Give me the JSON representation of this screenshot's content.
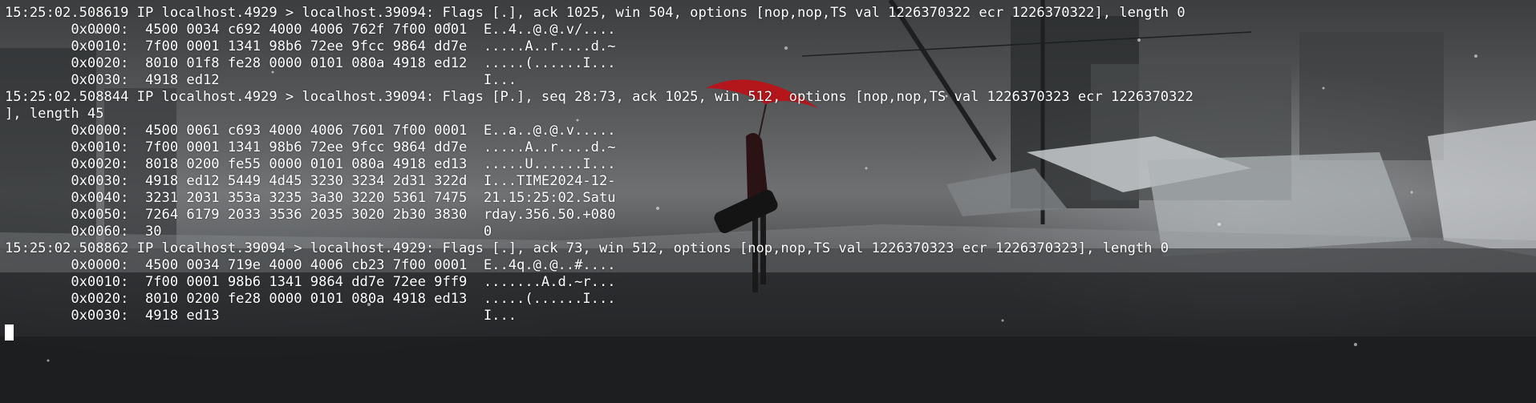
{
  "terminal": {
    "lines": [
      "15:25:02.508619 IP localhost.4929 > localhost.39094: Flags [.], ack 1025, win 504, options [nop,nop,TS val 1226370322 ecr 1226370322], length 0",
      "        0x0000:  4500 0034 c692 4000 4006 762f 7f00 0001  E..4..@.@.v/....",
      "        0x0010:  7f00 0001 1341 98b6 72ee 9fcc 9864 dd7e  .....A..r....d.~",
      "        0x0020:  8010 01f8 fe28 0000 0101 080a 4918 ed12  .....(......I...",
      "        0x0030:  4918 ed12                                I...",
      "15:25:02.508844 IP localhost.4929 > localhost.39094: Flags [P.], seq 28:73, ack 1025, win 512, options [nop,nop,TS val 1226370323 ecr 1226370322",
      "], length 45",
      "        0x0000:  4500 0061 c693 4000 4006 7601 7f00 0001  E..a..@.@.v.....",
      "        0x0010:  7f00 0001 1341 98b6 72ee 9fcc 9864 dd7e  .....A..r....d.~",
      "        0x0020:  8018 0200 fe55 0000 0101 080a 4918 ed13  .....U......I...",
      "        0x0030:  4918 ed12 5449 4d45 3230 3234 2d31 322d  I...TIME2024-12-",
      "        0x0040:  3231 2031 353a 3235 3a30 3220 5361 7475  21.15:25:02.Satu",
      "        0x0050:  7264 6179 2033 3536 2035 3020 2b30 3830  rday.356.50.+080",
      "        0x0060:  30                                       0",
      "15:25:02.508862 IP localhost.39094 > localhost.4929: Flags [.], ack 73, win 512, options [nop,nop,TS val 1226370323 ecr 1226370323], length 0",
      "        0x0000:  4500 0034 719e 4000 4006 cb23 7f00 0001  E..4q.@.@..#....",
      "        0x0010:  7f00 0001 98b6 1341 9864 dd7e 72ee 9ff9  .......A.d.~r...",
      "        0x0020:  8010 0200 fe28 0000 0101 080a 4918 ed13  .....(......I...",
      "        0x0030:  4918 ed13                                I..."
    ]
  },
  "colors": {
    "text": "#ffffff",
    "umbrella": "#b3161b",
    "background": "#3a3c3e"
  }
}
